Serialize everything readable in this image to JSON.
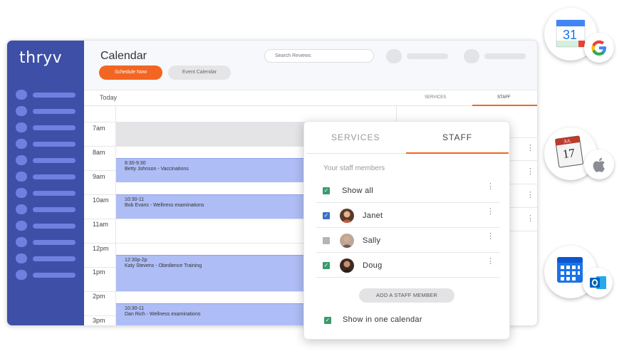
{
  "brand": {
    "logo": "thryv",
    "accent": "#f26522",
    "sidebar_color": "#3e4fa8",
    "event_color": "#aebdf5"
  },
  "header": {
    "title": "Calendar",
    "schedule_now": "Schedule Now",
    "event_calendar": "Event Calendar",
    "search_placeholder": "Search Reviews"
  },
  "subheader": {
    "today": "Today",
    "tab_services": "SERVICES",
    "tab_staff": "STAFF"
  },
  "times": [
    "7am",
    "8am",
    "9am",
    "10am",
    "11am",
    "12pm",
    "1pm",
    "2pm",
    "3pm"
  ],
  "events": [
    {
      "time": "8:30-9:30",
      "desc": "Betty Johnson - Vaccinations"
    },
    {
      "time": "10:30-11",
      "desc": "Bob Evans - Wellness examinations"
    },
    {
      "time": "12:30p-2p",
      "desc": "Katy Stevens - Obedience Training"
    },
    {
      "time": "10:30-11",
      "desc": "Dan Rich - Wellness examinations"
    }
  ],
  "popup": {
    "tab_services": "SERVICES",
    "tab_staff": "STAFF",
    "section_label": "Your staff members",
    "show_all": "Show all",
    "staff": [
      {
        "name": "Janet",
        "checked": true,
        "check_color": "#3f6fc4"
      },
      {
        "name": "Sally",
        "checked": false,
        "check_color": "#b5b5b8"
      },
      {
        "name": "Doug",
        "checked": true,
        "check_color": "#3a9a6b"
      }
    ],
    "add_staff": "ADD A STAFF MEMBER",
    "show_in_one_calendar": "Show in one calendar"
  },
  "integrations": {
    "google": {
      "day": "31"
    },
    "apple": {
      "day": "17",
      "month": "JUL"
    }
  }
}
